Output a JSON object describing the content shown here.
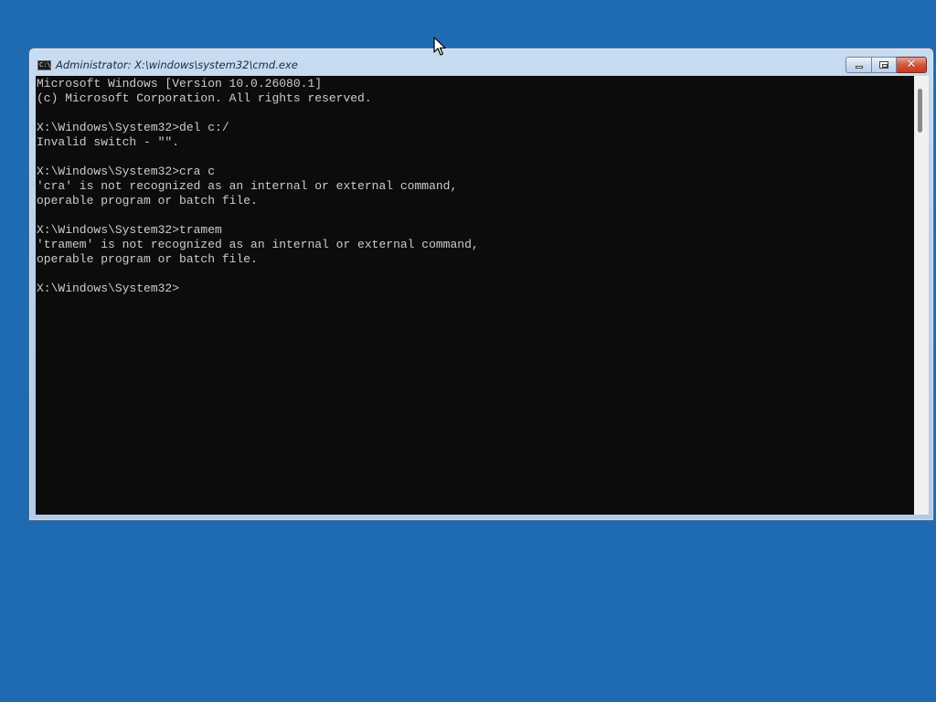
{
  "window": {
    "title": "Administrator: X:\\windows\\system32\\cmd.exe",
    "icon_label": "C:\\",
    "icons": {
      "app": "cmd-icon",
      "minimize": "minimize-icon",
      "maximize": "maximize-icon",
      "close": "close-icon"
    },
    "close_glyph": "✕"
  },
  "console": {
    "lines": [
      "Microsoft Windows [Version 10.0.26080.1]",
      "(c) Microsoft Corporation. All rights reserved.",
      "",
      "X:\\Windows\\System32>del c:/",
      "Invalid switch - \"\".",
      "",
      "X:\\Windows\\System32>cra c",
      "'cra' is not recognized as an internal or external command,",
      "operable program or batch file.",
      "",
      "X:\\Windows\\System32>tramem",
      "'tramem' is not recognized as an internal or external command,",
      "operable program or batch file.",
      "",
      "X:\\Windows\\System32>"
    ]
  },
  "colors": {
    "desktop": "#1f6bb3",
    "console_bg": "#0c0c0c",
    "console_text": "#cccccc"
  }
}
